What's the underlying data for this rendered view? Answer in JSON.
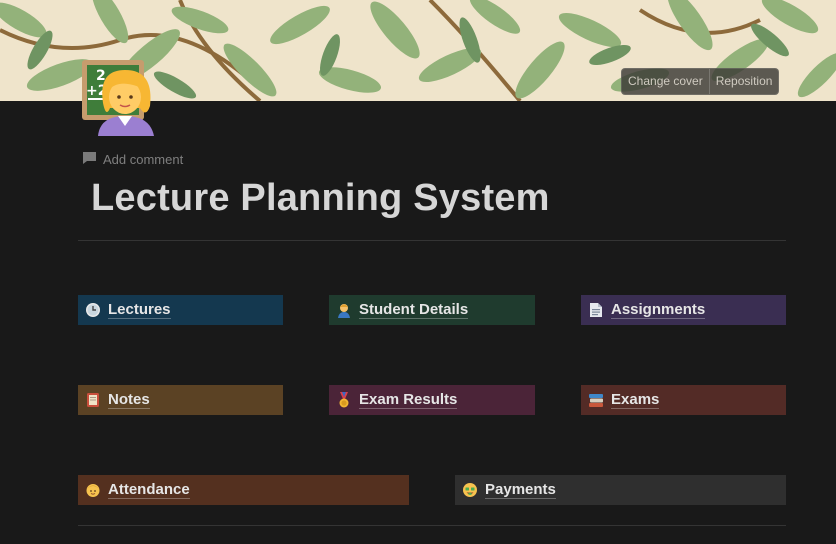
{
  "cover": {
    "change_cover_label": "Change cover",
    "reposition_label": "Reposition"
  },
  "page": {
    "add_comment_label": "Add comment",
    "title": "Lecture Planning System",
    "icon": "teacher-woman-emoji"
  },
  "links": [
    {
      "label": "Lectures",
      "icon": "clock-icon",
      "color": "#14384f"
    },
    {
      "label": "Student Details",
      "icon": "student-icon",
      "color": "#1f3b2e"
    },
    {
      "label": "Assignments",
      "icon": "document-icon",
      "color": "#3a2e52"
    },
    {
      "label": "Notes",
      "icon": "notebook-icon",
      "color": "#5b4224"
    },
    {
      "label": "Exam Results",
      "icon": "medal-icon",
      "color": "#4b2438"
    },
    {
      "label": "Exams",
      "icon": "books-icon",
      "color": "#532b26"
    },
    {
      "label": "Attendance",
      "icon": "face-icon",
      "color": "#54301f"
    },
    {
      "label": "Payments",
      "icon": "money-face-icon",
      "color": "#2f2f2f"
    }
  ]
}
